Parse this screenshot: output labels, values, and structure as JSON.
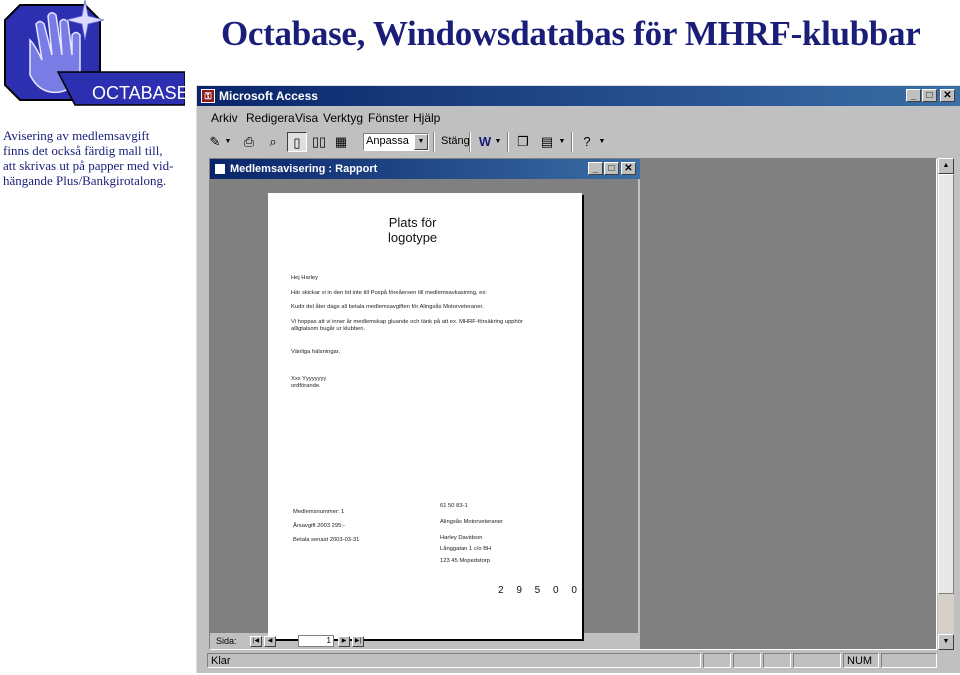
{
  "header": {
    "title": "Octabase, Windowsdatabas för MHRF-klubbar",
    "logo_text": "OCTABASE"
  },
  "caption": {
    "lines": [
      "Avisering av medlemsavgift",
      "finns det också färdig mall till,",
      "att skrivas ut på papper med vid-",
      "hängande Plus/Bankgirotalong."
    ]
  },
  "window": {
    "title": "Microsoft Access",
    "menu": [
      "Arkiv",
      "Redigera",
      "Visa",
      "Verktyg",
      "Fönster",
      "Hjälp"
    ],
    "toolbar": {
      "zoom_value": "Anpassa",
      "close_label": "Stäng"
    },
    "report": {
      "title": "Medlemsavisering : Rapport",
      "logo_placeholder": [
        "Plats för",
        "logotype"
      ],
      "body_lines": [
        "Hej Harley",
        "Här skickar vi in den tid inte till Pospå föreåersen till medlemsavkasining, ex:",
        "Kudir del åter dags all betala medlemsavgiften för Alingsås Motorveteraner.",
        "Vi hoppas att vi inner år medlemskap gluande och tänk på att ex. MHRF-försäkring upphör",
        "alligtalsom bugår ur klubben.",
        "Vänliga hälsningar,",
        "Xxx Yyyyyyyy",
        "ordförande."
      ],
      "slip_left": [
        "Medlemsnummer: 1",
        "Årsavgift 2003    295:-",
        "Betala senast 2003-03-31"
      ],
      "slip_right": [
        "61 50 83-1",
        "Alingsås Motorveteraner",
        "Harley Davidson",
        "Långgatan 1 c/o BH",
        "123 45 Mopedstorp"
      ],
      "amount": "2 9 5 0 0",
      "nav": {
        "label": "Sida:",
        "page": "1"
      }
    },
    "status": {
      "text": "Klar",
      "num": "NUM"
    }
  }
}
